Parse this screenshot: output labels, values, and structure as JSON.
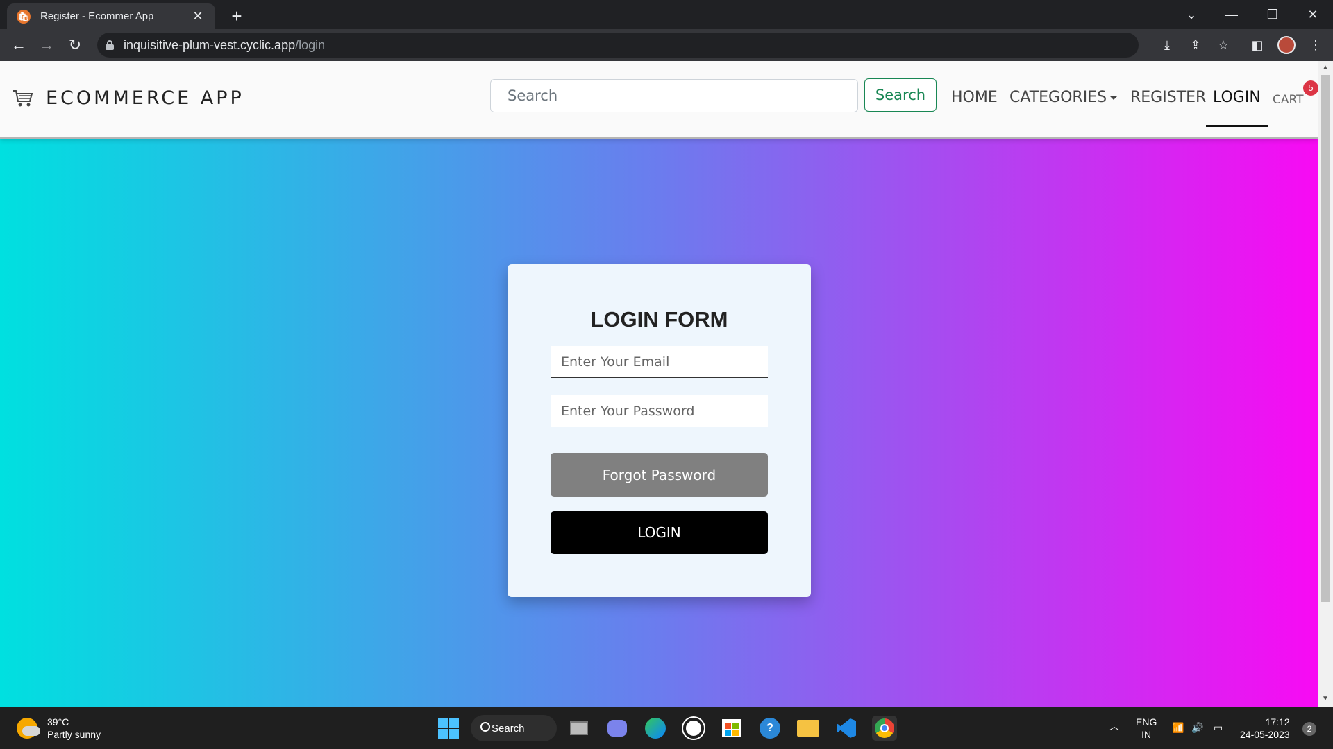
{
  "browser": {
    "tab_title": "Register - Ecommer App",
    "tab_close": "✕",
    "new_tab": "+",
    "url_host": "inquisitive-plum-vest.cyclic.app",
    "url_path": "/login",
    "window_controls": {
      "dropdown": "⌄",
      "minimize": "—",
      "restore": "❐",
      "close": "✕"
    }
  },
  "navbar": {
    "brand": "ECOMMERCE APP",
    "search_placeholder": "Search",
    "search_button": "Search",
    "links": {
      "home": "HOME",
      "categories": "CATEGORIES",
      "register": "REGISTER",
      "login": "LOGIN",
      "cart": "CART"
    },
    "cart_count": "5",
    "active_link": "LOGIN"
  },
  "login_form": {
    "title": "LOGIN FORM",
    "email_placeholder": "Enter Your Email",
    "password_placeholder": "Enter Your Password",
    "forgot_button": "Forgot Password",
    "login_button": "LOGIN"
  },
  "taskbar": {
    "weather_temp": "39°C",
    "weather_desc": "Partly sunny",
    "search_label": "Search",
    "lang_1": "ENG",
    "lang_2": "IN",
    "time": "17:12",
    "date": "24-05-2023",
    "notification_count": "2"
  },
  "colors": {
    "gradient_start": "#00e0e0",
    "gradient_mid": "#6b7cee",
    "gradient_end": "#f80af3",
    "search_button": "#198754",
    "badge": "#dc3545",
    "forgot_button": "#808080",
    "login_button": "#000000"
  }
}
